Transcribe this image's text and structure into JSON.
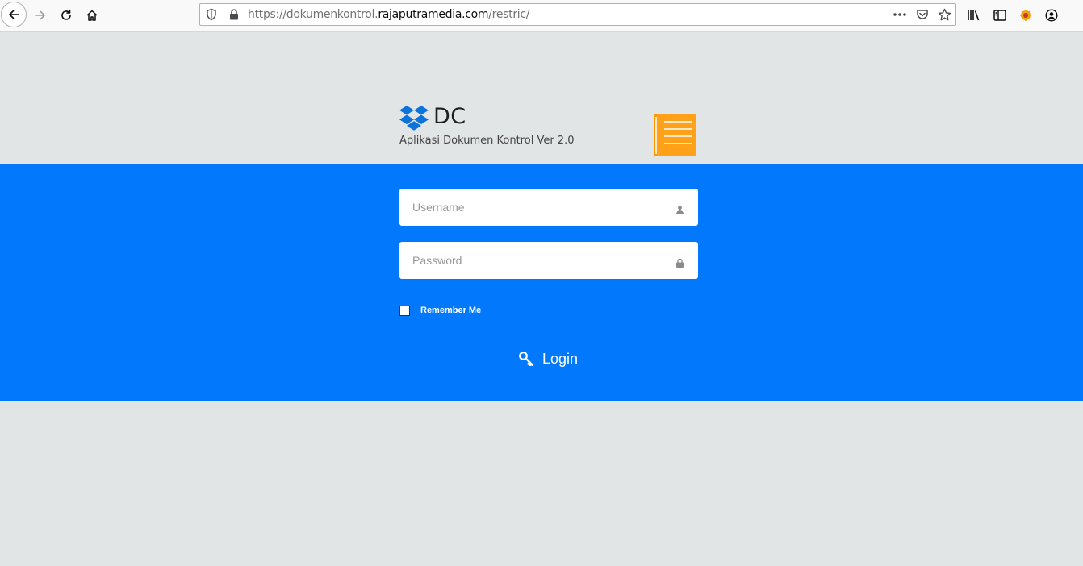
{
  "browser": {
    "url_prefix": "https://dokumenkontrol.",
    "url_host": "rajaputramedia.com",
    "url_path": "/restric/",
    "icons": [
      "back-icon",
      "forward-icon",
      "reload-icon",
      "home-icon",
      "shield-icon",
      "lock-icon",
      "page-actions-icon",
      "pocket-icon",
      "bookmark-star-icon",
      "library-icon",
      "sidebar-icon",
      "extension-icon",
      "account-icon"
    ]
  },
  "brand": {
    "title": "DC",
    "subtitle": "Aplikasi Dokumen Kontrol Ver 2.0",
    "logo_icon": "dropbox-icon",
    "doc_icon": "document-icon"
  },
  "form": {
    "username_placeholder": "Username",
    "username_icon": "user-icon",
    "password_placeholder": "Password",
    "password_icon": "lock-icon",
    "remember_label": "Remember Me",
    "remember_checked": false,
    "login_label": "Login",
    "login_icon": "key-icon"
  },
  "colors": {
    "band": "#0278fd",
    "page_bg": "#e2e5e6",
    "doc_icon": "#ff9800",
    "logo": "#0b73d9"
  }
}
